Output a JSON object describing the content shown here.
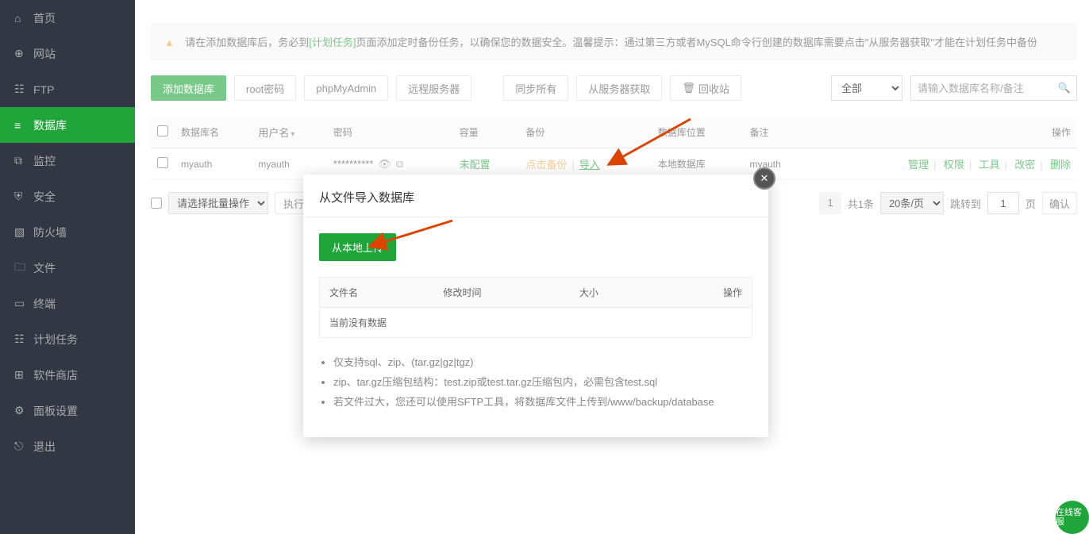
{
  "sidebar": {
    "items": [
      {
        "label": "首页",
        "icon": "home"
      },
      {
        "label": "网站",
        "icon": "globe"
      },
      {
        "label": "FTP",
        "icon": "ftp"
      },
      {
        "label": "数据库",
        "icon": "database",
        "active": true
      },
      {
        "label": "监控",
        "icon": "chart"
      },
      {
        "label": "安全",
        "icon": "shield"
      },
      {
        "label": "防火墙",
        "icon": "wall"
      },
      {
        "label": "文件",
        "icon": "folder"
      },
      {
        "label": "终端",
        "icon": "terminal"
      },
      {
        "label": "计划任务",
        "icon": "calendar"
      },
      {
        "label": "软件商店",
        "icon": "apps"
      },
      {
        "label": "面板设置",
        "icon": "gear"
      },
      {
        "label": "退出",
        "icon": "exit"
      }
    ]
  },
  "notice": {
    "prefix": "请在添加数据库后，务必到",
    "link": "[计划任务]",
    "text": "页面添加定时备份任务，以确保您的数据安全。温馨提示：通过第三方或者MySQL命令行创建的数据库需要点击\"从服务器获取\"才能在计划任务中备份"
  },
  "toolbar": {
    "add": "添加数据库",
    "root": "root密码",
    "pma": "phpMyAdmin",
    "remote": "远程服务器",
    "sync": "同步所有",
    "fetch": "从服务器获取",
    "trash": "回收站",
    "filter": "全部",
    "search_placeholder": "请输入数据库名称/备注"
  },
  "table": {
    "headers": {
      "name": "数据库名",
      "user": "用户名",
      "pwd": "密码",
      "quota": "容量",
      "backup": "备份",
      "location": "数据库位置",
      "note": "备注",
      "ops": "操作"
    },
    "row": {
      "name": "myauth",
      "user": "myauth",
      "pwd": "**********",
      "quota": "未配置",
      "backup_click": "点击备份",
      "backup_import": "导入",
      "location": "本地数据库",
      "note": "myauth",
      "ops": {
        "manage": "管理",
        "perm": "权限",
        "tools": "工具",
        "modify": "改密",
        "delete": "删除"
      }
    }
  },
  "pager": {
    "batch_placeholder": "请选择批量操作",
    "exec": "执行",
    "total": "共1条",
    "per_page": "20条/页",
    "jump_to": "跳转到",
    "page_unit": "页",
    "confirm": "确认",
    "page_num": "1",
    "current": "1"
  },
  "modal": {
    "title": "从文件导入数据库",
    "upload": "从本地上传",
    "headers": {
      "file": "文件名",
      "time": "修改时间",
      "size": "大小",
      "ops": "操作"
    },
    "empty": "当前没有数据",
    "tips": [
      "仅支持sql、zip、(tar.gz|gz|tgz)",
      "zip、tar.gz压缩包结构：test.zip或test.tar.gz压缩包内，必需包含test.sql",
      "若文件过大，您还可以使用SFTP工具，将数据库文件上传到/www/backup/database"
    ]
  },
  "float": "在线客服"
}
